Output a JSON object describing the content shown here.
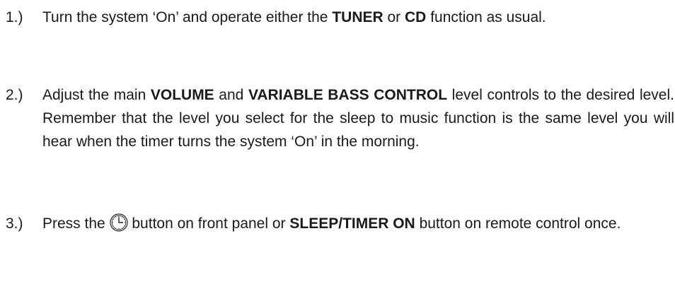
{
  "steps": [
    {
      "number": "1.)",
      "parts": [
        "Turn the system ‘On’ and operate either the ",
        "TUNER",
        " or ",
        "CD",
        " function as usual."
      ]
    },
    {
      "number": "2.)",
      "parts": [
        "Adjust the main ",
        "VOLUME",
        " and ",
        "VARIABLE BASS CONTROL",
        " level controls to the desired level. Remember that the level you select for the sleep to music function is the same level you will hear when the timer turns the system ‘On’ in the morning."
      ]
    },
    {
      "number": "3.)",
      "parts": [
        "Press the ",
        " button on front panel or ",
        "SLEEP/TIMER ON",
        " button on remote control once."
      ],
      "icon": "clock-icon"
    }
  ]
}
